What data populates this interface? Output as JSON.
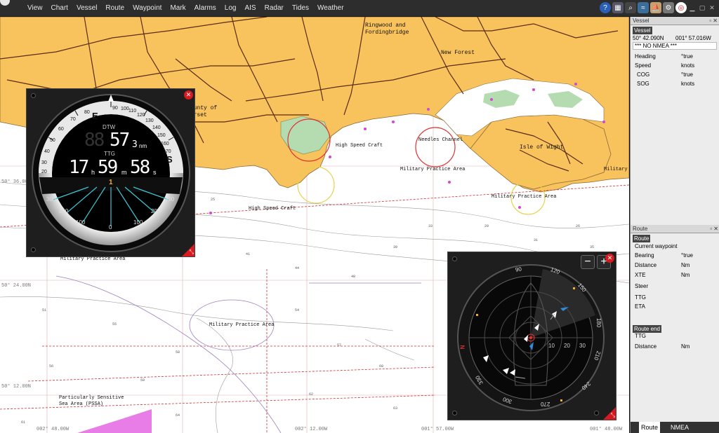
{
  "menu": [
    "View",
    "Chart",
    "Vessel",
    "Route",
    "Waypoint",
    "Mark",
    "Alarms",
    "Log",
    "AIS",
    "Radar",
    "Tides",
    "Weather"
  ],
  "tray_icons": [
    "help-icon",
    "chart-icon",
    "search-icon",
    "waves-icon",
    "sail-icon",
    "settings-icon",
    "lifebuoy-icon"
  ],
  "chart": {
    "labels": {
      "ringwood": "Ringwood and\nFordingbridge",
      "new_forest": "New Forest",
      "county": "County of\nDorset",
      "isle_of_wight": "Isle of Wight",
      "needles": "Needles Channel",
      "high_speed_1": "High Speed Craft",
      "high_speed_2": "High Speed Craft",
      "military_1": "Military Practice Area",
      "military_2": "Military Practice Area",
      "military_3": "Military Practice Area",
      "military_4": "Military Practice Area",
      "military_5": "Military",
      "pssa": "Particularly Sensitive\nSea Area (PSSA)",
      "lat_1": "50° 24.00N",
      "lat_2": "50° 12.00N",
      "lat_3": "50° 36.00N",
      "lon_1": "002° 48.00W",
      "lon_2": "002° 12.00W",
      "lon_3": "001° 57.00W",
      "lon_4": "001° 48.00W"
    }
  },
  "dtw_gauge": {
    "dtw_label": "DTW",
    "dtw_ghost": "88",
    "dtw_value": "57",
    "dtw_decimal": "3",
    "dtw_unit": "nm",
    "ttg_label": "TTG",
    "ttg_hours": "17",
    "ttg_hours_unit": "h",
    "ttg_minutes": "59",
    "ttg_minutes_unit": "m",
    "ttg_seconds": "58",
    "ttg_seconds_unit": "s",
    "waypoint_index": "1",
    "compass_letters": [
      "E",
      "S"
    ],
    "compass_ticks": [
      "90",
      "100",
      "110",
      "120",
      "130",
      "140",
      "150",
      "160",
      "170"
    ],
    "compass_ticks_left": [
      "80",
      "70",
      "60",
      "50",
      "40",
      "30",
      "20"
    ],
    "scale_labels": [
      "0",
      "100",
      "200",
      "300",
      "100",
      "200",
      "300"
    ],
    "close_label": "✕",
    "resize_label": "⤡"
  },
  "radar": {
    "zoom_out": "−",
    "zoom_in": "+",
    "close_label": "✕",
    "resize_label": "⤡",
    "range_labels": [
      "10",
      "20",
      "30"
    ],
    "bearings": [
      "90",
      "120",
      "150",
      "180",
      "210",
      "240",
      "270",
      "300",
      "330"
    ],
    "north": "N"
  },
  "sidebar": {
    "vessel": {
      "title": "Vessel",
      "tab": "Vessel",
      "lat": "50° 42.090N",
      "lon": "001° 57.016W",
      "nmea": "*** NO NMEA ***",
      "rows": [
        {
          "label": "Heading",
          "value": "°true"
        },
        {
          "label": "Speed",
          "value": "knots"
        },
        {
          "label": "COG",
          "value": "°true"
        },
        {
          "label": "SOG",
          "value": "knots"
        }
      ]
    },
    "route": {
      "title": "Route",
      "tab": "Route",
      "current_waypoint": "Current waypoint",
      "rows": [
        {
          "label": "Bearing",
          "value": "°true"
        },
        {
          "label": "Distance",
          "value": "Nm"
        },
        {
          "label": "XTE",
          "value": "Nm"
        },
        {
          "label": "Steer",
          "value": ""
        },
        {
          "label": "TTG",
          "value": ""
        },
        {
          "label": "ETA",
          "value": ""
        }
      ],
      "route_end": "Route end",
      "end_rows": [
        {
          "label": "TTG",
          "value": ""
        },
        {
          "label": "Distance",
          "value": "Nm"
        }
      ]
    },
    "bottom_tabs": [
      "Route",
      "NMEA"
    ]
  },
  "colors": {
    "land": "#f8c25c",
    "shallow": "#b5dcb0",
    "road": "#5a2d12",
    "gauge_bg": "#000000",
    "accent_red": "#d71920"
  }
}
